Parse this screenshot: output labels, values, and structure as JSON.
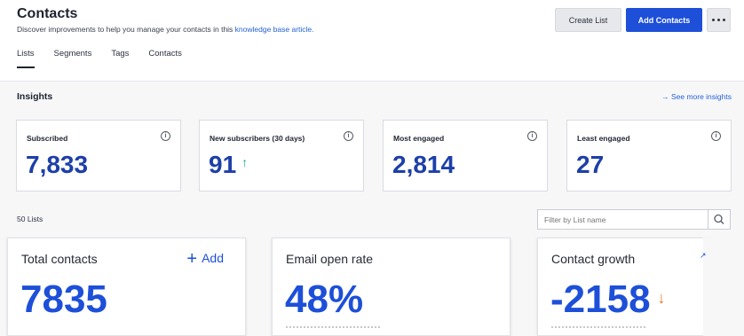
{
  "header": {
    "title": "Contacts",
    "subtitle": "Discover improvements to help you manage your contacts in this ",
    "subtitle_link": "knowledge base article.",
    "create_list_label": "Create List",
    "add_contacts_label": "Add Contacts"
  },
  "tabs": [
    {
      "label": "Lists",
      "active": true
    },
    {
      "label": "Segments",
      "active": false
    },
    {
      "label": "Tags",
      "active": false
    },
    {
      "label": "Contacts",
      "active": false
    }
  ],
  "insights": {
    "title": "Insights",
    "see_more": "→ See more insights",
    "cards": [
      {
        "label": "Subscribed",
        "value": "7,833"
      },
      {
        "label": "New subscribers (30 days)",
        "value": "91",
        "trend": "↑"
      },
      {
        "label": "Most engaged",
        "value": "2,814"
      },
      {
        "label": "Least engaged",
        "value": "27"
      }
    ]
  },
  "lists": {
    "count_label": "50 Lists",
    "filter_placeholder": "Filter by List name"
  },
  "stats": [
    {
      "label": "Total contacts",
      "value": "7835",
      "action": "Add",
      "action_icon": "+"
    },
    {
      "label": "Email open rate",
      "value": "48%"
    },
    {
      "label": "Contact growth",
      "value": "-2158",
      "trend": "↓"
    }
  ],
  "colors": {
    "accent": "#1d4fd8",
    "value_blue": "#1d3fa8",
    "trend_up": "#1aa89a",
    "trend_down": "#e0782a"
  }
}
